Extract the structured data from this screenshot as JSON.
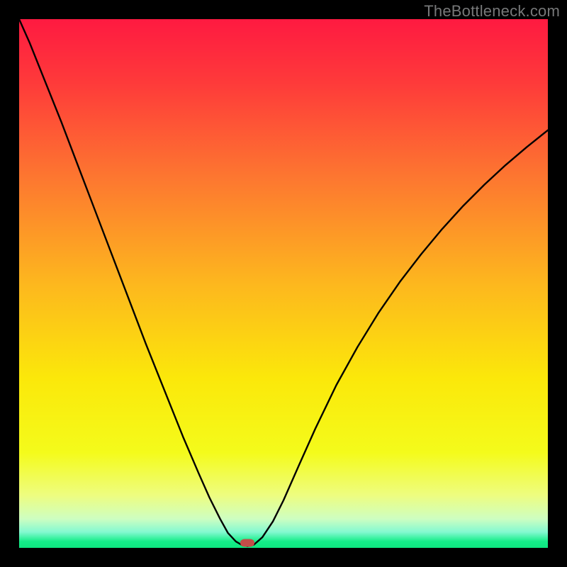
{
  "watermark": "TheBottleneck.com",
  "colors": {
    "frameBg": "#000000",
    "gradientStops": [
      {
        "offset": 0.0,
        "color": "#fe1a41"
      },
      {
        "offset": 0.12,
        "color": "#fe3a3a"
      },
      {
        "offset": 0.3,
        "color": "#fd7730"
      },
      {
        "offset": 0.5,
        "color": "#fdb71e"
      },
      {
        "offset": 0.68,
        "color": "#fbe80a"
      },
      {
        "offset": 0.82,
        "color": "#f4fb1b"
      },
      {
        "offset": 0.9,
        "color": "#eefd7f"
      },
      {
        "offset": 0.945,
        "color": "#cefec1"
      },
      {
        "offset": 0.97,
        "color": "#84f9d1"
      },
      {
        "offset": 0.988,
        "color": "#14ed88"
      },
      {
        "offset": 1.0,
        "color": "#0ee680"
      }
    ],
    "curveStroke": "#000000",
    "markerFill": "#c34d48"
  },
  "chart_data": {
    "type": "line",
    "title": "",
    "xlabel": "",
    "ylabel": "",
    "xlim": [
      0,
      100
    ],
    "ylim": [
      0,
      100
    ],
    "curve": {
      "name": "bottleneck-curve",
      "points": [
        {
          "x": 0.0,
          "y": 100.0
        },
        {
          "x": 2.0,
          "y": 95.5
        },
        {
          "x": 5.0,
          "y": 88.0
        },
        {
          "x": 8.0,
          "y": 80.5
        },
        {
          "x": 12.0,
          "y": 70.0
        },
        {
          "x": 16.0,
          "y": 59.5
        },
        {
          "x": 20.0,
          "y": 49.0
        },
        {
          "x": 24.0,
          "y": 38.5
        },
        {
          "x": 28.0,
          "y": 28.5
        },
        {
          "x": 31.0,
          "y": 21.0
        },
        {
          "x": 34.0,
          "y": 14.0
        },
        {
          "x": 36.0,
          "y": 9.5
        },
        {
          "x": 38.0,
          "y": 5.5
        },
        {
          "x": 39.5,
          "y": 2.8
        },
        {
          "x": 41.0,
          "y": 1.2
        },
        {
          "x": 42.2,
          "y": 0.5
        },
        {
          "x": 43.2,
          "y": 0.3
        },
        {
          "x": 44.4,
          "y": 0.6
        },
        {
          "x": 46.0,
          "y": 2.0
        },
        {
          "x": 48.0,
          "y": 5.0
        },
        {
          "x": 50.0,
          "y": 9.0
        },
        {
          "x": 53.0,
          "y": 15.8
        },
        {
          "x": 56.0,
          "y": 22.5
        },
        {
          "x": 60.0,
          "y": 30.8
        },
        {
          "x": 64.0,
          "y": 38.0
        },
        {
          "x": 68.0,
          "y": 44.5
        },
        {
          "x": 72.0,
          "y": 50.3
        },
        {
          "x": 76.0,
          "y": 55.5
        },
        {
          "x": 80.0,
          "y": 60.3
        },
        {
          "x": 84.0,
          "y": 64.7
        },
        {
          "x": 88.0,
          "y": 68.7
        },
        {
          "x": 92.0,
          "y": 72.4
        },
        {
          "x": 96.0,
          "y": 75.8
        },
        {
          "x": 100.0,
          "y": 79.0
        }
      ]
    },
    "marker": {
      "x": 43.2,
      "y": 1.0
    }
  }
}
